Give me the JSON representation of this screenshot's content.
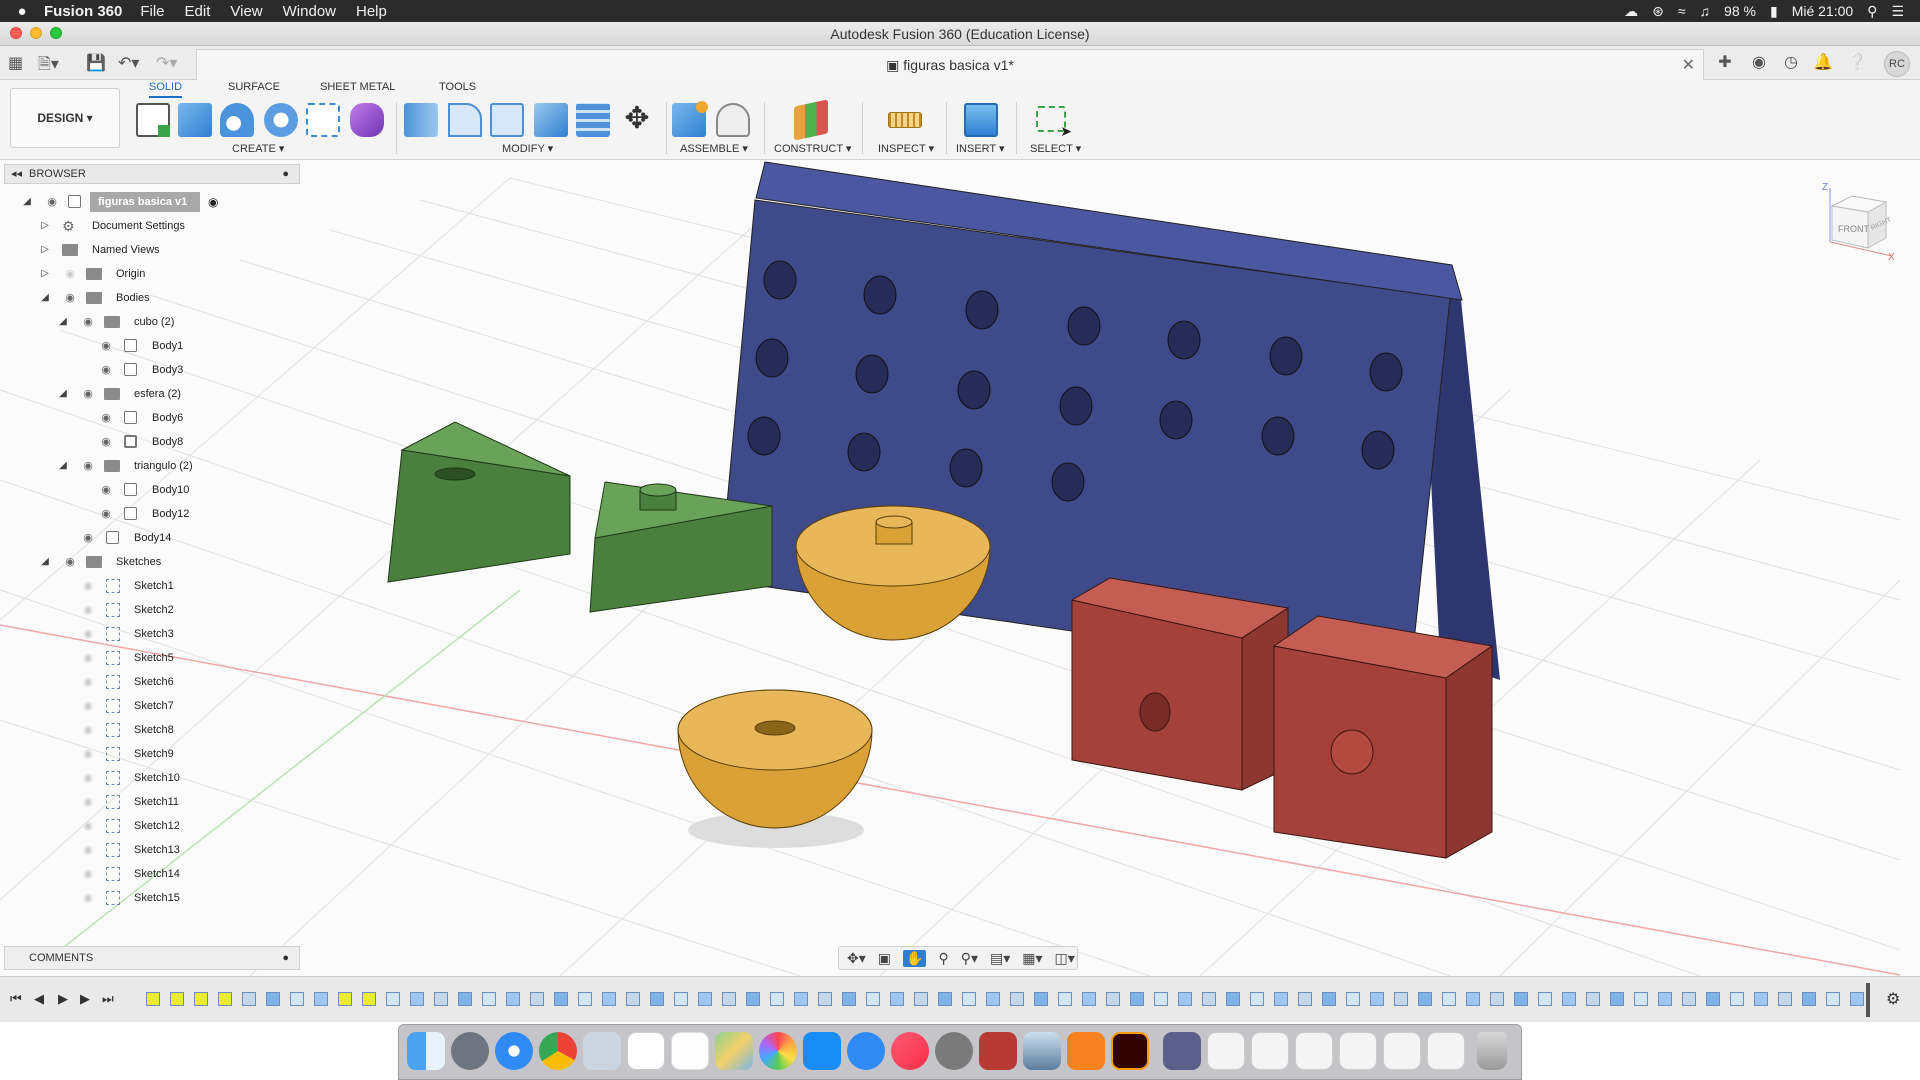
{
  "menubar": {
    "apple": "",
    "app_name": "Fusion 360",
    "items": [
      "File",
      "Edit",
      "View",
      "Window",
      "Help"
    ],
    "battery": "98 %",
    "clock": "Mié 21:00"
  },
  "window": {
    "title": "Autodesk Fusion 360 (Education License)",
    "document_tab": "figuras basica v1*",
    "avatar": "RC"
  },
  "toolbar": {
    "workspace": "DESIGN",
    "tabs": [
      "SOLID",
      "SURFACE",
      "SHEET METAL",
      "TOOLS"
    ],
    "active_tab": "SOLID",
    "groups": [
      "CREATE",
      "MODIFY",
      "ASSEMBLE",
      "CONSTRUCT",
      "INSPECT",
      "INSERT",
      "SELECT"
    ]
  },
  "browser": {
    "header": "BROWSER",
    "root": "figuras basica v1",
    "items": [
      {
        "label": "Document Settings",
        "kind": "gear"
      },
      {
        "label": "Named Views",
        "kind": "folder"
      },
      {
        "label": "Origin",
        "kind": "folder"
      },
      {
        "label": "Bodies",
        "kind": "folder"
      },
      {
        "label": "cubo (2)",
        "kind": "folder"
      },
      {
        "label": "Body1",
        "kind": "body"
      },
      {
        "label": "Body3",
        "kind": "body"
      },
      {
        "label": "esfera (2)",
        "kind": "folder"
      },
      {
        "label": "Body6",
        "kind": "body"
      },
      {
        "label": "Body8",
        "kind": "body"
      },
      {
        "label": "triangulo (2)",
        "kind": "folder"
      },
      {
        "label": "Body10",
        "kind": "body"
      },
      {
        "label": "Body12",
        "kind": "body"
      },
      {
        "label": "Body14",
        "kind": "body"
      },
      {
        "label": "Sketches",
        "kind": "folder"
      }
    ],
    "sketches": [
      "Sketch1",
      "Sketch2",
      "Sketch3",
      "Sketch5",
      "Sketch6",
      "Sketch7",
      "Sketch8",
      "Sketch9",
      "Sketch10",
      "Sketch11",
      "Sketch12",
      "Sketch13",
      "Sketch14",
      "Sketch15"
    ]
  },
  "comments": {
    "header": "COMMENTS"
  },
  "viewcube": {
    "front": "FRONT",
    "right": "RIGHT",
    "z": "Z",
    "x": "X"
  },
  "colors": {
    "board": "#3f4a8a",
    "cube": "#b8473f",
    "hemisphere": "#dba43a",
    "prism": "#5a8f4b",
    "accent": "#1a6fc4"
  }
}
